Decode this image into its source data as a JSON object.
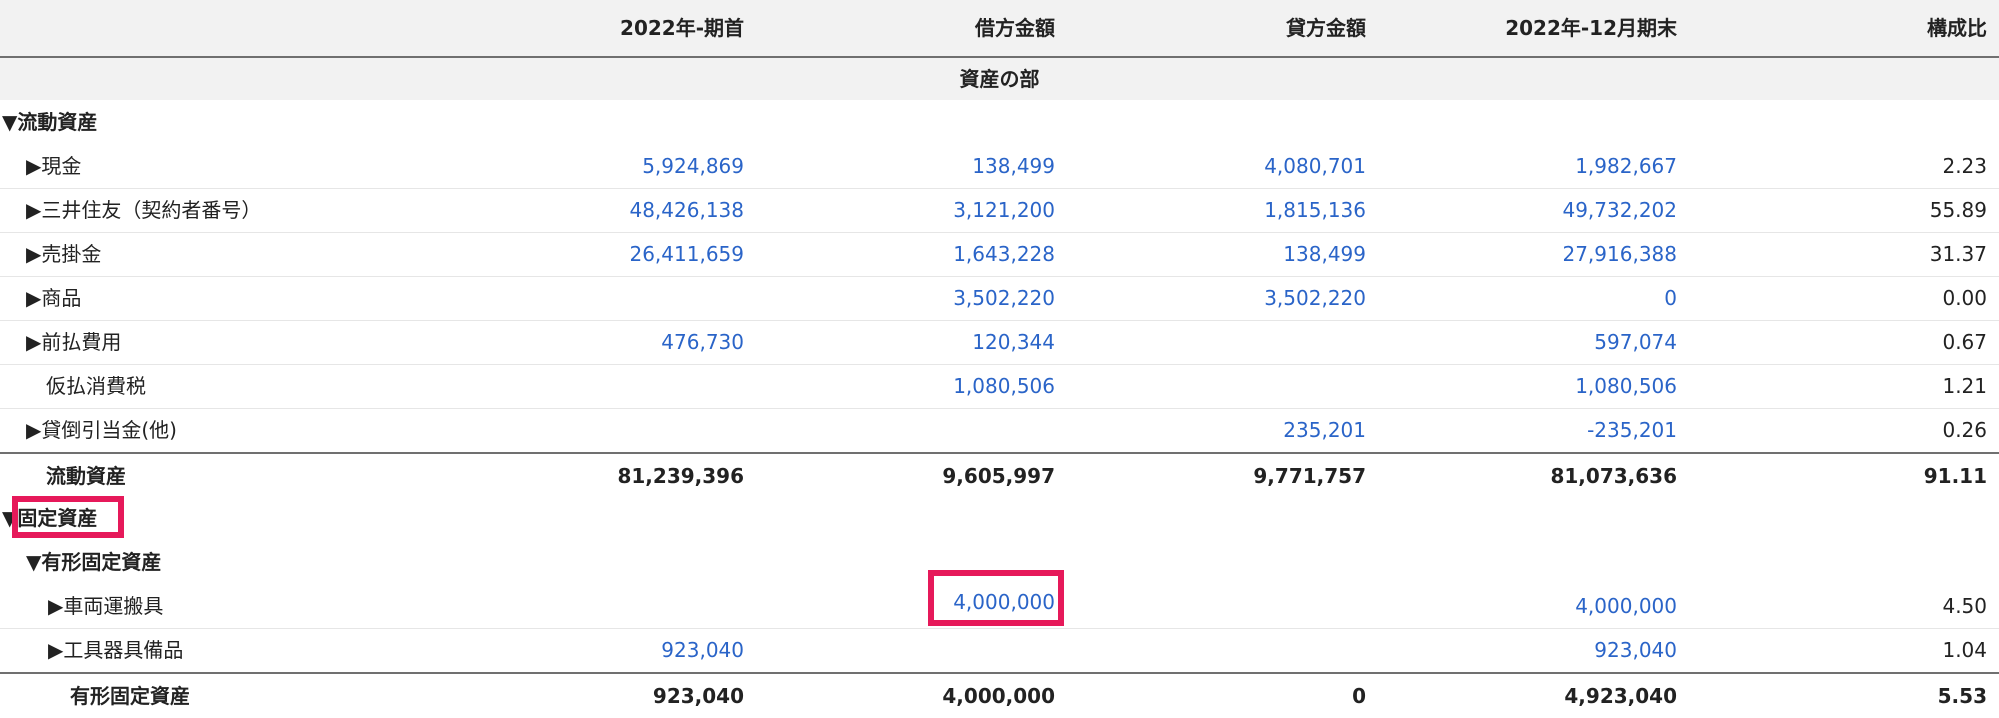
{
  "header": {
    "col_opening": "2022年-期首",
    "col_debit": "借方金額",
    "col_credit": "貸方金額",
    "col_closing": "2022年-12月期末",
    "col_ratio": "構成比"
  },
  "section_title": "資産の部",
  "current_assets": {
    "group_label": "▼流動資産",
    "rows": [
      {
        "label": "▶現金",
        "opening": "5,924,869",
        "debit": "138,499",
        "credit": "4,080,701",
        "closing": "1,982,667",
        "ratio": "2.23"
      },
      {
        "label": "▶三井住友（契約者番号）",
        "opening": "48,426,138",
        "debit": "3,121,200",
        "credit": "1,815,136",
        "closing": "49,732,202",
        "ratio": "55.89"
      },
      {
        "label": "▶売掛金",
        "opening": "26,411,659",
        "debit": "1,643,228",
        "credit": "138,499",
        "closing": "27,916,388",
        "ratio": "31.37"
      },
      {
        "label": "▶商品",
        "opening": "",
        "debit": "3,502,220",
        "credit": "3,502,220",
        "closing": "0",
        "ratio": "0.00"
      },
      {
        "label": "▶前払費用",
        "opening": "476,730",
        "debit": "120,344",
        "credit": "",
        "closing": "597,074",
        "ratio": "0.67"
      },
      {
        "label": "仮払消費税",
        "opening": "",
        "debit": "1,080,506",
        "credit": "",
        "closing": "1,080,506",
        "ratio": "1.21"
      },
      {
        "label": "▶貸倒引当金(他)",
        "opening": "",
        "debit": "",
        "credit": "235,201",
        "closing": "-235,201",
        "ratio": "0.26"
      }
    ],
    "total": {
      "label": "流動資産",
      "opening": "81,239,396",
      "debit": "9,605,997",
      "credit": "9,771,757",
      "closing": "81,073,636",
      "ratio": "91.11"
    }
  },
  "fixed_assets": {
    "group_label": "▼固定資産",
    "tangible": {
      "group_label": "▼有形固定資産",
      "rows": [
        {
          "label": "▶車両運搬具",
          "opening": "",
          "debit": "4,000,000",
          "credit": "",
          "closing": "4,000,000",
          "ratio": "4.50"
        },
        {
          "label": "▶工具器具備品",
          "opening": "923,040",
          "debit": "",
          "credit": "",
          "closing": "923,040",
          "ratio": "1.04"
        }
      ],
      "total": {
        "label": "有形固定資産",
        "opening": "923,040",
        "debit": "4,000,000",
        "credit": "0",
        "closing": "4,923,040",
        "ratio": "5.53"
      }
    }
  },
  "colors": {
    "link": "#2a64c8",
    "highlight": "#e6195a",
    "header_bg": "#f2f2f2"
  }
}
